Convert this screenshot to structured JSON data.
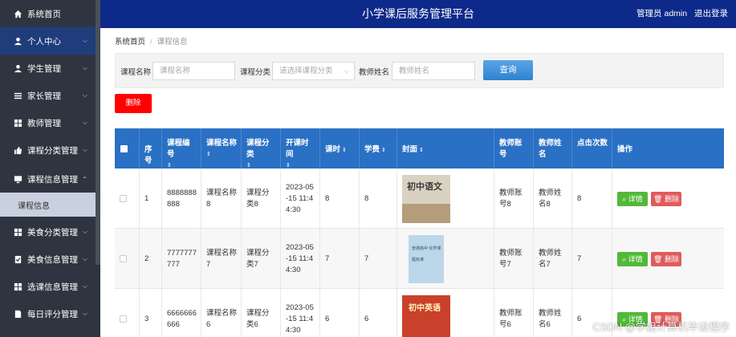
{
  "header": {
    "title": "小学课后服务管理平台",
    "admin": "管理员 admin",
    "logout": "退出登录"
  },
  "sidebar": {
    "items": [
      {
        "label": "系统首页",
        "icon": "home-icon"
      },
      {
        "label": "个人中心",
        "icon": "user-icon"
      },
      {
        "label": "学生管理",
        "icon": "user-icon"
      },
      {
        "label": "家长管理",
        "icon": "list-icon"
      },
      {
        "label": "教师管理",
        "icon": "grid-icon"
      },
      {
        "label": "课程分类管理",
        "icon": "thumb-icon"
      },
      {
        "label": "课程信息管理",
        "icon": "monitor-icon"
      },
      {
        "label": "美食分类管理",
        "icon": "grid-icon"
      },
      {
        "label": "美食信息管理",
        "icon": "check-icon"
      },
      {
        "label": "选课信息管理",
        "icon": "grid-icon"
      },
      {
        "label": "每日评分管理",
        "icon": "doc-icon"
      }
    ],
    "submenu": "课程信息"
  },
  "breadcrumb": {
    "home": "系统首页",
    "current": "课程信息"
  },
  "search": {
    "name_label": "课程名称",
    "name_placeholder": "课程名称",
    "category_label": "课程分类",
    "category_placeholder": "请选择课程分类",
    "teacher_label": "教师姓名",
    "teacher_placeholder": "教师姓名",
    "query": "查询"
  },
  "delete_label": "删除",
  "table": {
    "headers": [
      "序号",
      "课程编号",
      "课程名称",
      "课程分类",
      "开课时间",
      "课时",
      "学费",
      "封面",
      "教师账号",
      "教师姓名",
      "点击次数",
      "操作"
    ],
    "sort_glyph": "⇕",
    "rows": [
      {
        "index": "1",
        "code": "8888888888",
        "name": "课程名称8",
        "category": "课程分类8",
        "time": "2023-05-15 11:44:30",
        "hours": "8",
        "fee": "8",
        "cover_text": "初中语文",
        "account": "教师账号8",
        "teacher": "教师姓名8",
        "clicks": "8"
      },
      {
        "index": "2",
        "code": "7777777777",
        "name": "课程名称7",
        "category": "课程分类7",
        "time": "2023-05-15 11:44:30",
        "hours": "7",
        "fee": "7",
        "cover_text": "普通高中 化学课程标准",
        "account": "教师账号7",
        "teacher": "教师姓名7",
        "clicks": "7"
      },
      {
        "index": "3",
        "code": "6666666666",
        "name": "课程名称6",
        "category": "课程分类6",
        "time": "2023-05-15 11:44:30",
        "hours": "6",
        "fee": "6",
        "cover_text": "初中英语",
        "account": "教师账号6",
        "teacher": "教师姓名6",
        "clicks": "6"
      }
    ],
    "detail_label": "详情",
    "row_delete_label": "删除"
  },
  "watermark": "CSDN @学姐计算机毕设程序",
  "colors": {
    "sidebar": "#2f3540",
    "header": "#0d2a8a",
    "table_head": "#2a70c4",
    "query": "#3b8ed8",
    "delete": "#ff0000",
    "detail": "#52b83a",
    "row_delete": "#e05b5b"
  }
}
